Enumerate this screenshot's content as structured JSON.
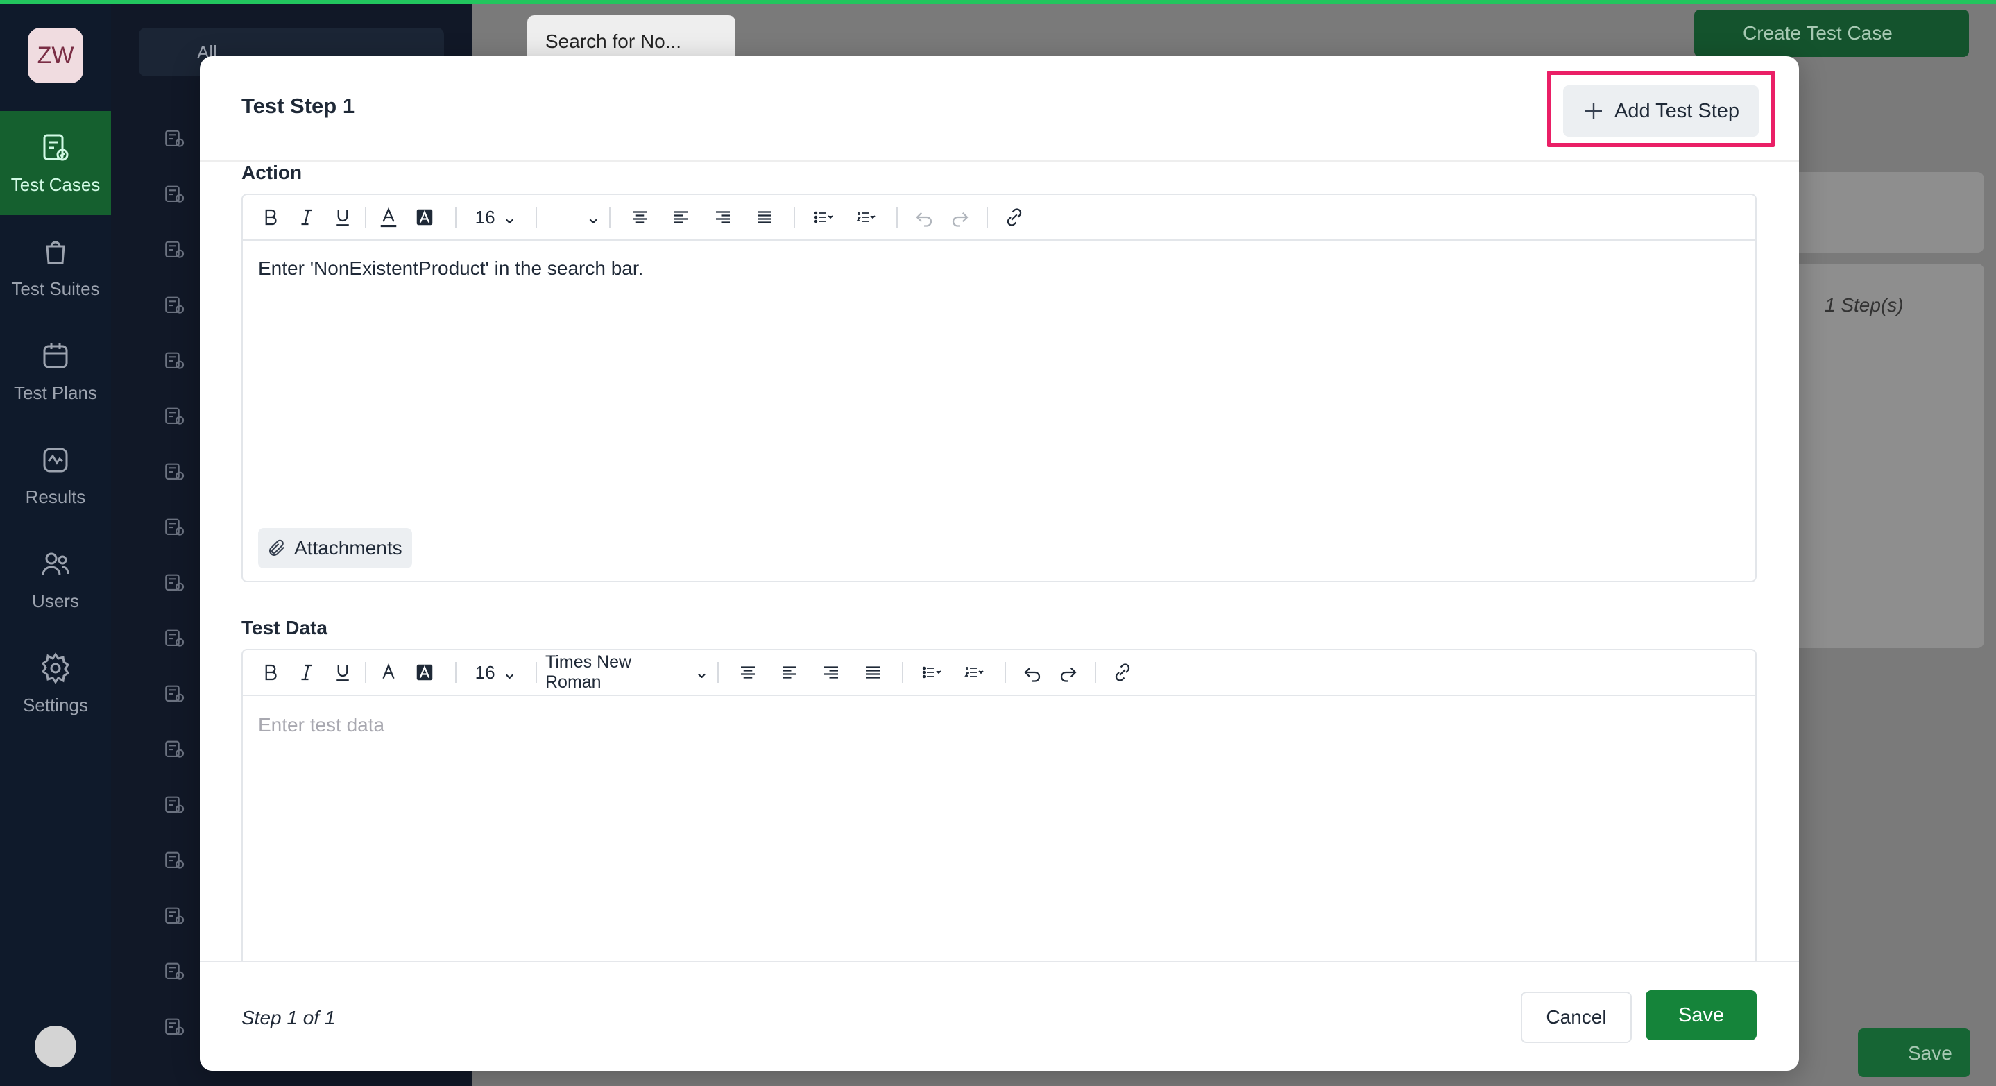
{
  "app": {
    "user_initials": "ZW",
    "nav": [
      {
        "label": "Test Cases",
        "icon": "test-cases-icon",
        "active": true
      },
      {
        "label": "Test Suites",
        "icon": "bag-icon",
        "active": false
      },
      {
        "label": "Test Plans",
        "icon": "calendar-icon",
        "active": false
      },
      {
        "label": "Results",
        "icon": "pulse-icon",
        "active": false
      },
      {
        "label": "Users",
        "icon": "users-icon",
        "active": false
      },
      {
        "label": "Settings",
        "icon": "gear-icon",
        "active": false
      }
    ],
    "filter_label": "All",
    "search_value": "Search for No...",
    "create_button": "Create Test Case",
    "steps_count": "1 Step(s)",
    "save_label": "Save"
  },
  "modal": {
    "title": "Test Step 1",
    "add_step_label": "Add Test Step",
    "action": {
      "label": "Action",
      "font_size": "16",
      "font_family": "",
      "content": "Enter 'NonExistentProduct' in the search bar.",
      "attachments_label": "Attachments"
    },
    "test_data": {
      "label": "Test Data",
      "font_size": "16",
      "font_family": "Times New Roman",
      "placeholder": "Enter test data"
    },
    "footer": {
      "step_counter": "Step 1 of 1",
      "cancel_label": "Cancel",
      "save_label": "Save"
    }
  },
  "colors": {
    "primary_green": "#15843a",
    "highlight": "#ea1f66",
    "sidebar_bg": "#0f1a2b"
  }
}
